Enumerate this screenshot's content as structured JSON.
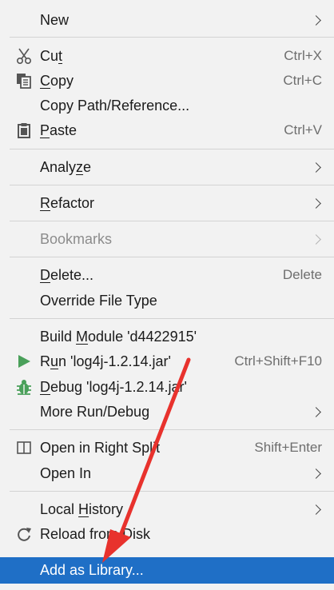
{
  "menu": {
    "new": {
      "label": "New"
    },
    "cut": {
      "pre": "Cu",
      "u": "t",
      "post": "",
      "shortcut": "Ctrl+X"
    },
    "copy": {
      "pre": "",
      "u": "C",
      "post": "opy",
      "shortcut": "Ctrl+C"
    },
    "copy_path": {
      "label": "Copy Path/Reference..."
    },
    "paste": {
      "pre": "",
      "u": "P",
      "post": "aste",
      "shortcut": "Ctrl+V"
    },
    "analyze": {
      "pre": "Analy",
      "u": "z",
      "post": "e"
    },
    "refactor": {
      "pre": "",
      "u": "R",
      "post": "efactor"
    },
    "bookmarks": {
      "label": "Bookmarks"
    },
    "delete": {
      "pre": "",
      "u": "D",
      "post": "elete...",
      "shortcut": "Delete"
    },
    "override": {
      "label": "Override File Type"
    },
    "build": {
      "pre": "Build ",
      "u": "M",
      "post": "odule 'd4422915'"
    },
    "run": {
      "pre": "R",
      "u": "u",
      "post": "n 'log4j-1.2.14.jar'",
      "shortcut": "Ctrl+Shift+F10"
    },
    "debug": {
      "pre": "",
      "u": "D",
      "post": "ebug 'log4j-1.2.14.jar'"
    },
    "more_run": {
      "label": "More Run/Debug"
    },
    "open_split": {
      "label": "Open in Right Split",
      "shortcut": "Shift+Enter"
    },
    "open_in": {
      "label": "Open In"
    },
    "local_history": {
      "pre": "Local ",
      "u": "H",
      "post": "istory"
    },
    "reload": {
      "label": "Reload from Disk"
    },
    "add_library": {
      "label": "Add as Library..."
    }
  },
  "colors": {
    "selection": "#1f6fc6",
    "annotation_arrow": "#e8322d",
    "run_icon": "#4aa05a",
    "debug_icon": "#4aa05a"
  },
  "icons": [
    "scissors-icon",
    "copy-icon",
    "clipboard-icon",
    "run-icon",
    "debug-bug-icon",
    "split-icon",
    "reload-icon",
    "chevron-right-icon"
  ]
}
